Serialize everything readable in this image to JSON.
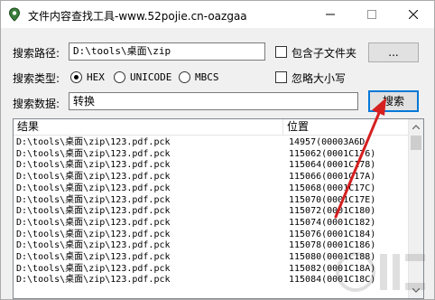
{
  "window": {
    "title": "文件内容查找工具-www.52pojie.cn-oazgaa"
  },
  "search_path": {
    "label": "搜索路径:",
    "value": "D:\\tools\\桌面\\zip",
    "include_subfolders_label": "包含子文件夹",
    "include_subfolders_checked": false,
    "browse_label": "..."
  },
  "search_type": {
    "label": "搜索类型:",
    "options": [
      "HEX",
      "UNICODE",
      "MBCS"
    ],
    "selected": "HEX",
    "ignore_case_label": "忽略大小写",
    "ignore_case_checked": false
  },
  "search_data": {
    "label": "搜索数据:",
    "value": "转换",
    "search_button_label": "搜索"
  },
  "results": {
    "columns": [
      "结果",
      "位置"
    ],
    "rows": [
      {
        "path": "D:\\tools\\桌面\\zip\\123.pdf.pck",
        "pos": "14957(00003A6D"
      },
      {
        "path": "D:\\tools\\桌面\\zip\\123.pdf.pck",
        "pos": "115062(0001C176)"
      },
      {
        "path": "D:\\tools\\桌面\\zip\\123.pdf.pck",
        "pos": "115064(0001C178)"
      },
      {
        "path": "D:\\tools\\桌面\\zip\\123.pdf.pck",
        "pos": "115066(0001C17A)"
      },
      {
        "path": "D:\\tools\\桌面\\zip\\123.pdf.pck",
        "pos": "115068(0001C17C)"
      },
      {
        "path": "D:\\tools\\桌面\\zip\\123.pdf.pck",
        "pos": "115070(0001C17E)"
      },
      {
        "path": "D:\\tools\\桌面\\zip\\123.pdf.pck",
        "pos": "115072(0001C180)"
      },
      {
        "path": "D:\\tools\\桌面\\zip\\123.pdf.pck",
        "pos": "115074(0001C182)"
      },
      {
        "path": "D:\\tools\\桌面\\zip\\123.pdf.pck",
        "pos": "115076(0001C184)"
      },
      {
        "path": "D:\\tools\\桌面\\zip\\123.pdf.pck",
        "pos": "115078(0001C186)"
      },
      {
        "path": "D:\\tools\\桌面\\zip\\123.pdf.pck",
        "pos": "115080(0001C188)"
      },
      {
        "path": "D:\\tools\\桌面\\zip\\123.pdf.pck",
        "pos": "115082(0001C18A)"
      },
      {
        "path": "D:\\tools\\桌面\\zip\\123.pdf.pck",
        "pos": "115084(0001C18C)"
      }
    ]
  },
  "colors": {
    "annotation_arrow": "#d62020",
    "focus_border": "#0078d7"
  }
}
